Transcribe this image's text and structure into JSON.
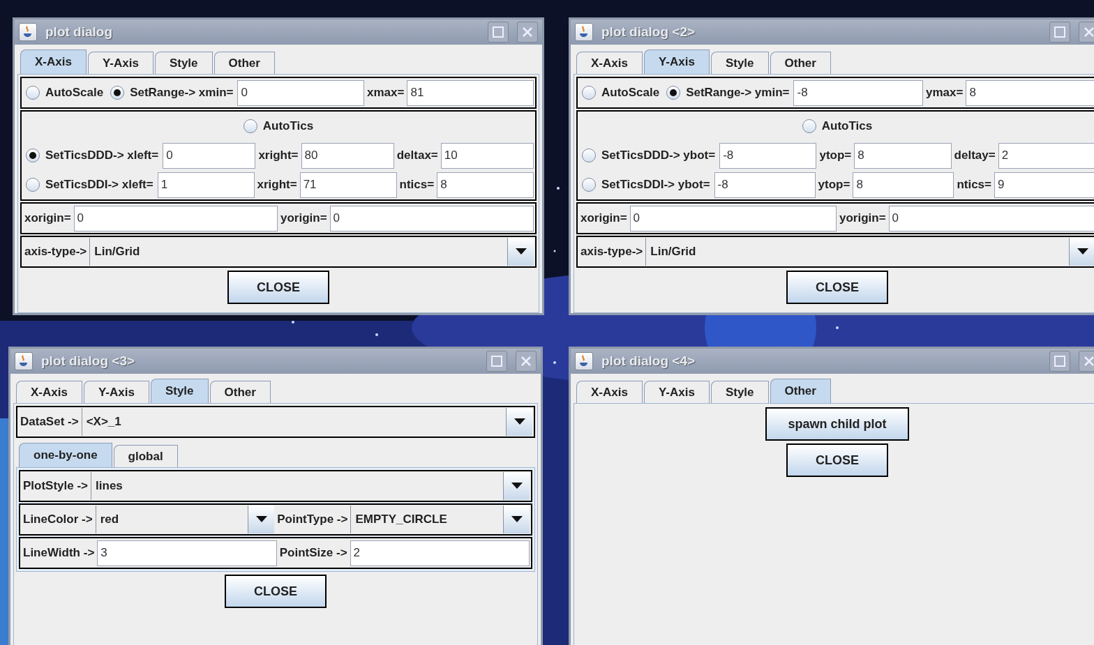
{
  "windows": [
    {
      "title": "plot dialog",
      "tabs": [
        {
          "label": "X-Axis",
          "selected": true
        },
        {
          "label": "Y-Axis",
          "selected": false
        },
        {
          "label": "Style",
          "selected": false
        },
        {
          "label": "Other",
          "selected": false
        }
      ],
      "blocks": [
        {
          "kind": "panel",
          "rows": [
            [
              {
                "kind": "radio",
                "label": "AutoScale",
                "selected": false
              },
              {
                "kind": "radio",
                "label": "SetRange-> xmin=",
                "selected": true
              },
              {
                "kind": "field",
                "value": "0"
              },
              {
                "kind": "label",
                "text": "xmax="
              },
              {
                "kind": "field",
                "value": "81"
              }
            ]
          ]
        },
        {
          "kind": "panel",
          "header": {
            "kind": "radio",
            "label": "AutoTics",
            "selected": false
          },
          "rows": [
            [
              {
                "kind": "radio",
                "label": "SetTicsDDD-> xleft=",
                "selected": true
              },
              {
                "kind": "field",
                "value": "0"
              },
              {
                "kind": "label",
                "text": "xright="
              },
              {
                "kind": "field",
                "value": "80"
              },
              {
                "kind": "label",
                "text": "deltax="
              },
              {
                "kind": "field",
                "value": "10"
              }
            ],
            [
              {
                "kind": "radio",
                "label": "SetTicsDDI-> xleft=",
                "selected": false
              },
              {
                "kind": "field",
                "value": "1"
              },
              {
                "kind": "label",
                "text": "xright="
              },
              {
                "kind": "field",
                "value": "71"
              },
              {
                "kind": "label",
                "text": "ntics="
              },
              {
                "kind": "field",
                "value": "8"
              }
            ]
          ]
        },
        {
          "kind": "panel",
          "rows": [
            [
              {
                "kind": "label",
                "text": "xorigin="
              },
              {
                "kind": "field",
                "value": "0"
              },
              {
                "kind": "label",
                "text": "yorigin="
              },
              {
                "kind": "field",
                "value": "0"
              }
            ]
          ]
        },
        {
          "kind": "panel",
          "rows": [
            [
              {
                "kind": "label",
                "text": "axis-type->"
              },
              {
                "kind": "combo",
                "value": "Lin/Grid"
              }
            ]
          ]
        },
        {
          "kind": "button",
          "label": "CLOSE"
        }
      ]
    },
    {
      "title": "plot dialog <2>",
      "tabs": [
        {
          "label": "X-Axis",
          "selected": false
        },
        {
          "label": "Y-Axis",
          "selected": true
        },
        {
          "label": "Style",
          "selected": false
        },
        {
          "label": "Other",
          "selected": false
        }
      ],
      "blocks": [
        {
          "kind": "panel",
          "rows": [
            [
              {
                "kind": "radio",
                "label": "AutoScale",
                "selected": false
              },
              {
                "kind": "radio",
                "label": "SetRange-> ymin=",
                "selected": true
              },
              {
                "kind": "field",
                "value": "-8"
              },
              {
                "kind": "label",
                "text": "ymax="
              },
              {
                "kind": "field",
                "value": "8"
              }
            ]
          ]
        },
        {
          "kind": "panel",
          "header": {
            "kind": "radio",
            "label": "AutoTics",
            "selected": false
          },
          "rows": [
            [
              {
                "kind": "radio",
                "label": "SetTicsDDD-> ybot=",
                "selected": false
              },
              {
                "kind": "field",
                "value": "-8"
              },
              {
                "kind": "label",
                "text": "ytop="
              },
              {
                "kind": "field",
                "value": "8"
              },
              {
                "kind": "label",
                "text": "deltay="
              },
              {
                "kind": "field",
                "value": "2"
              }
            ],
            [
              {
                "kind": "radio",
                "label": "SetTicsDDI-> ybot=",
                "selected": false
              },
              {
                "kind": "field",
                "value": "-8"
              },
              {
                "kind": "label",
                "text": "ytop="
              },
              {
                "kind": "field",
                "value": "8"
              },
              {
                "kind": "label",
                "text": "ntics="
              },
              {
                "kind": "field",
                "value": "9"
              }
            ]
          ]
        },
        {
          "kind": "panel",
          "rows": [
            [
              {
                "kind": "label",
                "text": "xorigin="
              },
              {
                "kind": "field",
                "value": "0"
              },
              {
                "kind": "label",
                "text": "yorigin="
              },
              {
                "kind": "field",
                "value": "0"
              }
            ]
          ]
        },
        {
          "kind": "panel",
          "rows": [
            [
              {
                "kind": "label",
                "text": "axis-type->"
              },
              {
                "kind": "combo",
                "value": "Lin/Grid"
              }
            ]
          ]
        },
        {
          "kind": "button",
          "label": "CLOSE"
        }
      ]
    },
    {
      "title": "plot dialog <3>",
      "tabs": [
        {
          "label": "X-Axis",
          "selected": false
        },
        {
          "label": "Y-Axis",
          "selected": false
        },
        {
          "label": "Style",
          "selected": true
        },
        {
          "label": "Other",
          "selected": false
        }
      ],
      "blocks": [
        {
          "kind": "panel",
          "rows": [
            [
              {
                "kind": "label",
                "text": "DataSet ->"
              },
              {
                "kind": "combo",
                "value": "<X>_1"
              }
            ]
          ]
        },
        {
          "kind": "subtabs",
          "tabs": [
            {
              "label": "one-by-one",
              "selected": true
            },
            {
              "label": "global",
              "selected": false
            }
          ],
          "panels": [
            {
              "rows": [
                [
                  {
                    "kind": "label",
                    "text": "PlotStyle ->"
                  },
                  {
                    "kind": "combo",
                    "value": "lines"
                  }
                ]
              ]
            },
            {
              "rows": [
                [
                  {
                    "kind": "label",
                    "text": "LineColor ->"
                  },
                  {
                    "kind": "combo",
                    "value": "red"
                  },
                  {
                    "kind": "label",
                    "text": "PointType ->"
                  },
                  {
                    "kind": "combo",
                    "value": "EMPTY_CIRCLE"
                  }
                ]
              ]
            },
            {
              "rows": [
                [
                  {
                    "kind": "label",
                    "text": "LineWidth ->"
                  },
                  {
                    "kind": "field",
                    "value": "3"
                  },
                  {
                    "kind": "label",
                    "text": "PointSize ->"
                  },
                  {
                    "kind": "field",
                    "value": "2"
                  }
                ]
              ]
            }
          ]
        },
        {
          "kind": "button",
          "label": "CLOSE"
        }
      ]
    },
    {
      "title": "plot dialog <4>",
      "tabs": [
        {
          "label": "X-Axis",
          "selected": false
        },
        {
          "label": "Y-Axis",
          "selected": false
        },
        {
          "label": "Style",
          "selected": false
        },
        {
          "label": "Other",
          "selected": true
        }
      ],
      "blocks": [
        {
          "kind": "button",
          "label": "spawn child plot"
        },
        {
          "kind": "button",
          "label": "CLOSE"
        }
      ]
    }
  ]
}
